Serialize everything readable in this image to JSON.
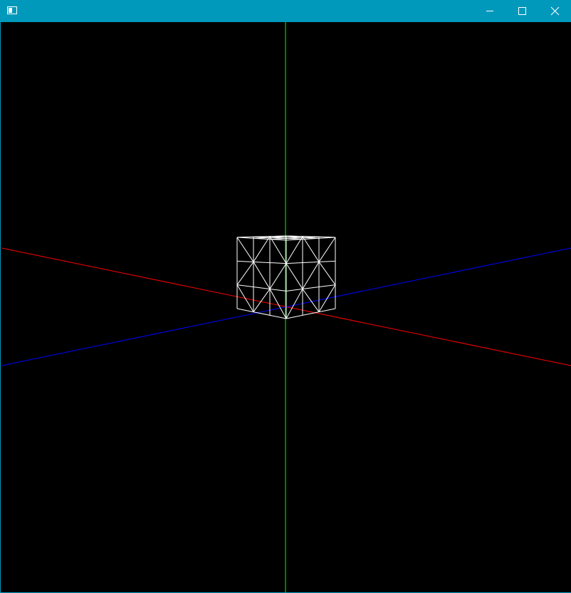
{
  "window": {
    "title": "",
    "icon": "app-window-icon",
    "controls": [
      "minimize-icon",
      "maximize-icon",
      "close-icon"
    ],
    "titlebar_color": "#0099bc"
  },
  "scene": {
    "background_color": "#000000",
    "axes": [
      {
        "name": "x-axis",
        "color": "#ff0000"
      },
      {
        "name": "y-axis",
        "color": "#00ff00"
      },
      {
        "name": "z-axis",
        "color": "#0000ff"
      }
    ],
    "mesh": {
      "shape": "cube",
      "render_mode": "wireframe",
      "subdivisions_per_edge": 3,
      "color": "#ffffff"
    }
  }
}
